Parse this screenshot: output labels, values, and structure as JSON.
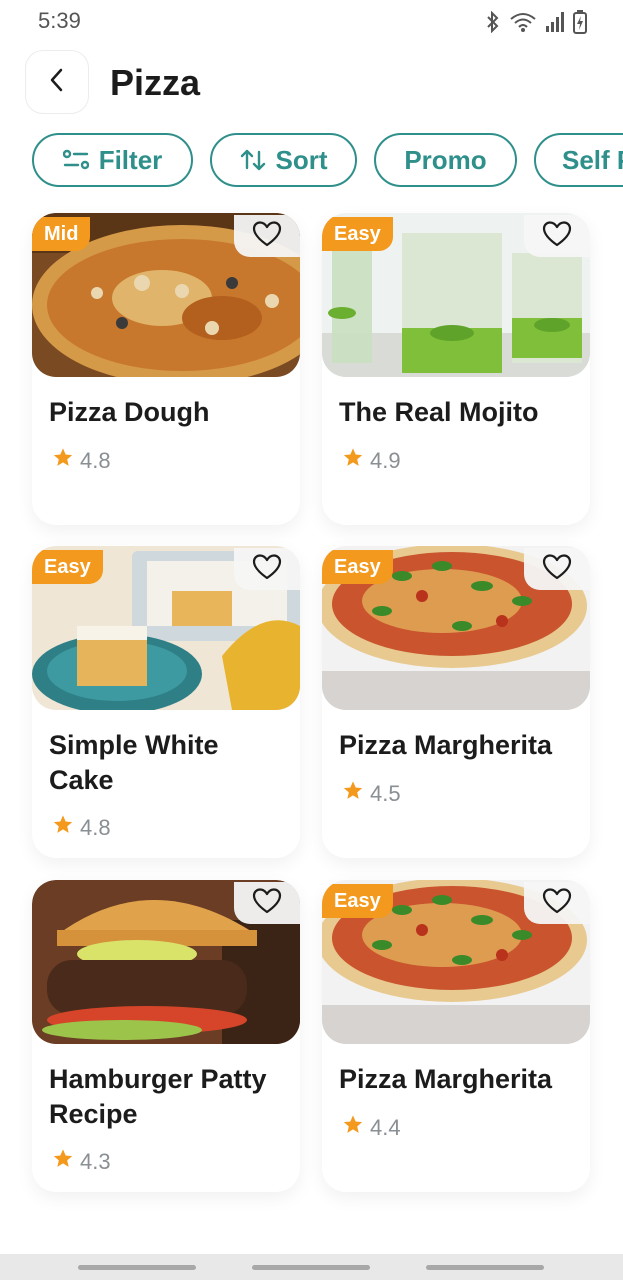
{
  "status_bar": {
    "time": "5:39"
  },
  "header": {
    "title": "Pizza"
  },
  "chips": [
    {
      "label": "Filter",
      "icon": "filter-icon"
    },
    {
      "label": "Sort",
      "icon": "sort-icon"
    },
    {
      "label": "Promo"
    },
    {
      "label": "Self P"
    }
  ],
  "cards": [
    {
      "title": "Pizza Dough",
      "rating": "4.8",
      "badge": "Mid",
      "image": "pizza-dough-photo"
    },
    {
      "title": "The Real Mojito",
      "rating": "4.9",
      "badge": "Easy",
      "image": "mojito-photo"
    },
    {
      "title": "Simple White Cake",
      "rating": "4.8",
      "badge": "Easy",
      "image": "white-cake-photo"
    },
    {
      "title": "Pizza Margherita",
      "rating": "4.5",
      "badge": "Easy",
      "image": "pizza-margherita-photo"
    },
    {
      "title": "Hamburger Patty Recipe",
      "rating": "4.3",
      "badge": "",
      "image": "hamburger-photo"
    },
    {
      "title": "Pizza Margherita",
      "rating": "4.4",
      "badge": "Easy",
      "image": "pizza-margherita-photo"
    }
  ],
  "colors": {
    "accent": "#2f8f8a",
    "badge": "#f39a1e",
    "star": "#f39a1e"
  }
}
